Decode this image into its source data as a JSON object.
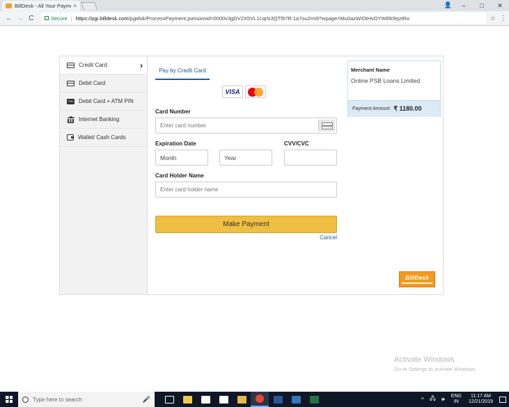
{
  "browser": {
    "tab_title": "BillDesk - All Your Payme",
    "tab_close": "×",
    "window_controls": {
      "account": "👤",
      "minimize": "–",
      "maximize": "□",
      "close": "✕"
    },
    "nav": {
      "back": "←",
      "forward": "→",
      "reload": "C"
    },
    "secure_label": "Secure",
    "url_host": "https://pgi.billdesk.com",
    "url_path": "/pgidsk/ProcessPayment;jsessionid=0000v3gDV2X5VL1Lqrls3QTl97R:1a7ou2mi9?wpage=Mu0azWiOtHvOYW6fcfejztRo",
    "star": "☆",
    "menu": "⋮"
  },
  "sidebar": {
    "items": [
      {
        "label": "Credit Card",
        "icon": "credit-card-icon",
        "active": true
      },
      {
        "label": "Debit Card",
        "icon": "debit-card-icon"
      },
      {
        "label": "Debit Card + ATM PIN",
        "icon": "atm-pin-icon",
        "icon_text": "PIN"
      },
      {
        "label": "Internet Banking",
        "icon": "bank-icon"
      },
      {
        "label": "Wallet/ Cash Cards",
        "icon": "wallet-icon"
      }
    ],
    "chevron": "›"
  },
  "form": {
    "tab_label": "Pay by Credit Card",
    "card_logos": {
      "visa": "VISA"
    },
    "card_number_label": "Card Number",
    "card_number_placeholder": "Enter card number",
    "expiration_label": "Expiration Date",
    "month_value": "Month",
    "year_value": "Year",
    "cvv_label": "CVV/CVC",
    "holder_label": "Card Holder Name",
    "holder_placeholder": "Enter card holder name",
    "pay_button": "Make Payment",
    "cancel_link": "Cancel"
  },
  "summary": {
    "merchant_label": "Merchant Name",
    "merchant_name": "Online PSB Loans Limited",
    "amount_label": "Payment Amount:",
    "amount_value": "₹ 1180.00"
  },
  "branding": {
    "billdesk_name": "BillDesk"
  },
  "watermark": {
    "title": "Activate Windows",
    "subtitle": "Go to Settings to activate Windows."
  },
  "taskbar": {
    "search_placeholder": "Type here to search",
    "mic": "🎤",
    "apps": [
      {
        "name": "task-view-icon",
        "color": "#ffffff"
      },
      {
        "name": "file-explorer-icon",
        "color": "#f2c94c"
      },
      {
        "name": "store-icon",
        "color": "#ffffff"
      },
      {
        "name": "mail-icon",
        "color": "#ffffff"
      },
      {
        "name": "folder-icon",
        "color": "#e8b94a"
      },
      {
        "name": "chrome-icon",
        "color": "#e5483a",
        "active": true
      },
      {
        "name": "word-icon",
        "color": "#2b579a"
      },
      {
        "name": "edge-icon",
        "color": "#3277bc"
      },
      {
        "name": "excel-icon",
        "color": "#217346"
      }
    ],
    "tray_icons": {
      "chevron": "^",
      "network": "🖧",
      "volume": "🕪"
    },
    "lang_top": "ENG",
    "lang_bottom": "IN",
    "time": "11:17 AM",
    "date": "12/21/2019"
  },
  "colors": {
    "accent_blue": "#1e56a0",
    "pay_button": "#f0be42",
    "amount_bg": "#dbeaf5",
    "billdesk_orange": "#f39a1e"
  }
}
